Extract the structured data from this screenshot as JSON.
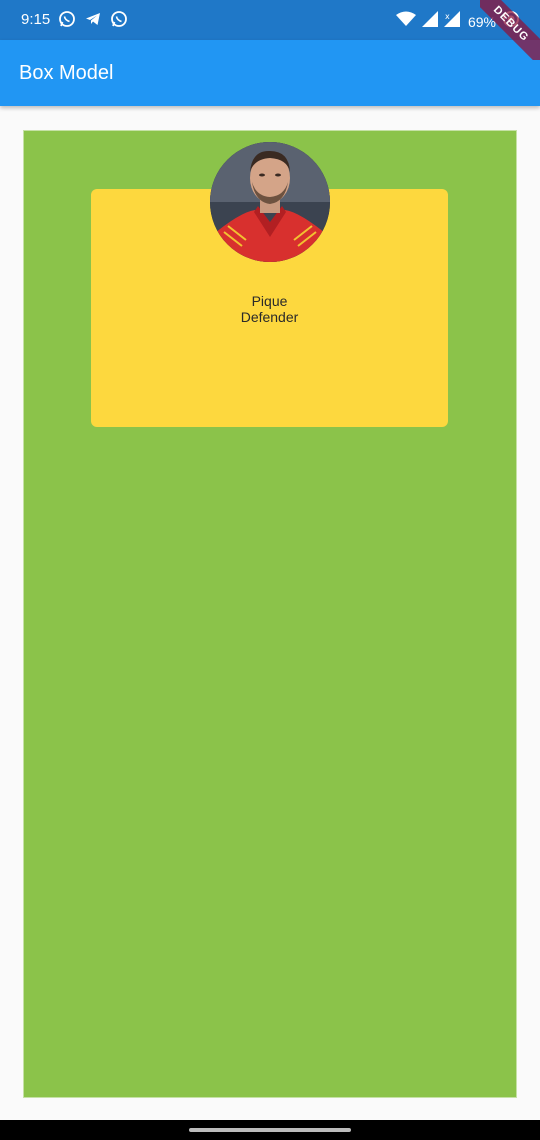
{
  "status_bar": {
    "time": "9:15",
    "battery": "69%",
    "icons": [
      "whatsapp-icon",
      "telegram-icon",
      "whatsapp-icon",
      "wifi-icon",
      "signal-icon",
      "signal-no-service-icon",
      "battery-icon"
    ]
  },
  "app_bar": {
    "title": "Box Model",
    "debug_label": "DEBUG"
  },
  "card": {
    "name": "Pique",
    "role": "Defender"
  },
  "colors": {
    "status_bar": "#1f78c8",
    "app_bar": "#2196f3",
    "outer_box": "#8bc34a",
    "card": "#fdd83e"
  }
}
